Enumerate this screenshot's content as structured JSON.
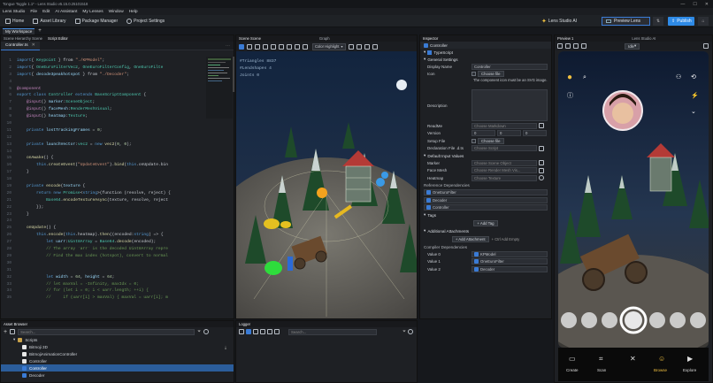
{
  "titlebar": {
    "title": "Tongue Toggle 1.1* - Lens Studio v5.15.0.25101518",
    "min": "—",
    "max": "☐",
    "close": "✕"
  },
  "menu": [
    "Lens Studio",
    "File",
    "Edit",
    "AI Assistant",
    "My Lenses",
    "Window",
    "Help"
  ],
  "toolbar": {
    "home": "Home",
    "asset_library": "Asset Library",
    "package_manager": "Package Manager",
    "project_settings": "Project Settings",
    "ai_label": "Lens Studio AI",
    "preview_lens": "Preview Lens",
    "publish": "Publish"
  },
  "workspace": {
    "tab": "My Workspace",
    "add": "+"
  },
  "editor": {
    "tabs": [
      "Scene Hierarchy Scene",
      "Script Editor"
    ],
    "file_tab": "Controller.ts",
    "lines": [
      {
        "n": "1",
        "segs": [
          [
            "kw",
            "import"
          ],
          [
            "",
            "{ "
          ],
          [
            "cls",
            "Keypoint"
          ],
          [
            "",
            " } from "
          ],
          [
            "str",
            "\"./KPModel\""
          ],
          [
            "",
            ";"
          ]
        ]
      },
      {
        "n": "2",
        "segs": [
          [
            "kw",
            "import"
          ],
          [
            "",
            "{ "
          ],
          [
            "cls",
            "OneEuroFilterVec2"
          ],
          [
            "",
            ", "
          ],
          [
            "cls",
            "OneEuroFilterConfig"
          ],
          [
            "",
            ", "
          ],
          [
            "cls",
            "OneEuroFilte"
          ]
        ]
      },
      {
        "n": "3",
        "segs": [
          [
            "kw",
            "import"
          ],
          [
            "",
            "{ "
          ],
          [
            "var",
            "decode3peakhotspot"
          ],
          [
            "",
            " } from "
          ],
          [
            "str",
            "\"./Decoder\""
          ],
          [
            "",
            ";"
          ]
        ]
      },
      {
        "n": "4",
        "segs": []
      },
      {
        "n": "5",
        "segs": [
          [
            "dec",
            "@component"
          ]
        ]
      },
      {
        "n": "6",
        "segs": [
          [
            "kw",
            "export class "
          ],
          [
            "cls",
            "Controller"
          ],
          [
            "kw",
            " extends "
          ],
          [
            "cls",
            "BaseScriptComponent"
          ],
          [
            "",
            " {"
          ]
        ]
      },
      {
        "n": "7",
        "segs": [
          [
            "",
            "    "
          ],
          [
            "dec",
            "@input"
          ],
          [
            "",
            "() "
          ],
          [
            "var",
            "marker"
          ],
          [
            "",
            ":"
          ],
          [
            "cls",
            "SceneObject"
          ],
          [
            "",
            ";"
          ]
        ]
      },
      {
        "n": "8",
        "segs": [
          [
            "",
            "    "
          ],
          [
            "dec",
            "@input"
          ],
          [
            "",
            "() "
          ],
          [
            "var",
            "faceMesh"
          ],
          [
            "",
            ":"
          ],
          [
            "cls",
            "RenderMeshVisual"
          ],
          [
            "",
            ";"
          ]
        ]
      },
      {
        "n": "9",
        "segs": [
          [
            "",
            "    "
          ],
          [
            "dec",
            "@input"
          ],
          [
            "",
            "() "
          ],
          [
            "var",
            "heatmap"
          ],
          [
            "",
            ":"
          ],
          [
            "cls",
            "Texture"
          ],
          [
            "",
            ";"
          ]
        ]
      },
      {
        "n": "10",
        "segs": []
      },
      {
        "n": "11",
        "segs": [
          [
            "",
            "    "
          ],
          [
            "kw",
            "private "
          ],
          [
            "var",
            "lostTrackingFrames"
          ],
          [
            "",
            " = "
          ],
          [
            "num",
            "0"
          ],
          [
            "",
            ";"
          ]
        ]
      },
      {
        "n": "12",
        "segs": []
      },
      {
        "n": "13",
        "segs": [
          [
            "",
            "    "
          ],
          [
            "kw",
            "private "
          ],
          [
            "var",
            "launchVector"
          ],
          [
            "",
            ":"
          ],
          [
            "cls",
            "vec2"
          ],
          [
            "",
            " = "
          ],
          [
            "kw",
            "new "
          ],
          [
            "fn",
            "vec2"
          ],
          [
            "",
            "("
          ],
          [
            "num",
            "0"
          ],
          [
            "",
            ", "
          ],
          [
            "num",
            "0"
          ],
          [
            "",
            ");"
          ]
        ]
      },
      {
        "n": "14",
        "segs": []
      },
      {
        "n": "15",
        "segs": [
          [
            "",
            "    "
          ],
          [
            "fn",
            "onAwake"
          ],
          [
            "",
            "() {"
          ]
        ]
      },
      {
        "n": "16",
        "segs": [
          [
            "",
            "        "
          ],
          [
            "kw",
            "this"
          ],
          [
            "",
            "."
          ],
          [
            "fn",
            "createEvent"
          ],
          [
            "",
            "("
          ],
          [
            "str",
            "\"UpdateEvent\""
          ],
          [
            "",
            ")."
          ],
          [
            "fn",
            "bind"
          ],
          [
            "",
            "("
          ],
          [
            "kw",
            "this"
          ],
          [
            "",
            ".onUpdate.bin"
          ]
        ]
      },
      {
        "n": "17",
        "segs": [
          [
            "",
            "    }"
          ]
        ]
      },
      {
        "n": "18",
        "segs": []
      },
      {
        "n": "19",
        "segs": [
          [
            "",
            "    "
          ],
          [
            "kw",
            "private "
          ],
          [
            "fn",
            "encode"
          ],
          [
            "",
            "("
          ],
          [
            "var",
            "texture"
          ],
          [
            "",
            " {"
          ]
        ]
      },
      {
        "n": "20",
        "segs": [
          [
            "",
            "        "
          ],
          [
            "kw",
            "return new "
          ],
          [
            "cls",
            "Promise"
          ],
          [
            "",
            "<"
          ],
          [
            "kw",
            "string"
          ],
          [
            "",
            ">"
          ],
          [
            "",
            "(function (resolve, reject) {"
          ]
        ]
      },
      {
        "n": "21",
        "segs": [
          [
            "",
            "            "
          ],
          [
            "cls",
            "Base64"
          ],
          [
            "",
            "."
          ],
          [
            "fn",
            "encodeTextureAsync"
          ],
          [
            "",
            "(texture, resolve, reject"
          ]
        ]
      },
      {
        "n": "22",
        "segs": [
          [
            "",
            "        });"
          ]
        ]
      },
      {
        "n": "23",
        "segs": [
          [
            "",
            "    }"
          ]
        ]
      },
      {
        "n": "24",
        "segs": []
      },
      {
        "n": "25",
        "segs": [
          [
            "",
            "    "
          ],
          [
            "fn",
            "onUpdate"
          ],
          [
            "",
            "() {"
          ]
        ]
      },
      {
        "n": "26",
        "segs": [
          [
            "",
            "        "
          ],
          [
            "kw",
            "this"
          ],
          [
            "",
            "."
          ],
          [
            "fn",
            "encode"
          ],
          [
            "",
            "("
          ],
          [
            "kw",
            "this"
          ],
          [
            "",
            ".heatmap)."
          ],
          [
            "fn",
            "then"
          ],
          [
            "",
            "((encoded:"
          ],
          [
            "kw",
            "string"
          ],
          [
            "",
            ") => {"
          ]
        ]
      },
      {
        "n": "27",
        "segs": [
          [
            "",
            "            "
          ],
          [
            "kw",
            "let "
          ],
          [
            "var",
            "uarr"
          ],
          [
            "",
            ":"
          ],
          [
            "cls",
            "Uint8Array"
          ],
          [
            "",
            " = "
          ],
          [
            "cls",
            "Base64"
          ],
          [
            "",
            "."
          ],
          [
            "fn",
            "decode"
          ],
          [
            "",
            "(encoded);"
          ]
        ]
      },
      {
        "n": "28",
        "segs": [
          [
            "cm",
            "            // The array `arr` is the decoded Uint8Array repre"
          ]
        ]
      },
      {
        "n": "29",
        "segs": [
          [
            "cm",
            "            // Find the max index (hotspot), convert to normal"
          ]
        ]
      },
      {
        "n": "30",
        "segs": []
      },
      {
        "n": "31",
        "segs": []
      },
      {
        "n": "32",
        "segs": [
          [
            "",
            "            "
          ],
          [
            "kw",
            "let "
          ],
          [
            "var",
            "width"
          ],
          [
            "",
            " = "
          ],
          [
            "num",
            "64"
          ],
          [
            "",
            ", "
          ],
          [
            "var",
            "height"
          ],
          [
            "",
            " = "
          ],
          [
            "num",
            "64"
          ],
          [
            "",
            ";"
          ]
        ]
      },
      {
        "n": "33",
        "segs": [
          [
            "cm",
            "            // let maxVal = -Infinity, maxIdx = 0;"
          ]
        ]
      },
      {
        "n": "34",
        "segs": [
          [
            "cm",
            "            // for (let i = 0; i < uarr.length; ++i) {"
          ]
        ]
      },
      {
        "n": "35",
        "segs": [
          [
            "cm",
            "            //     if (uarr[i] > maxVal) { maxVal = uarr[i]; m"
          ]
        ]
      }
    ]
  },
  "scene": {
    "tab": "Scene Scene",
    "graph_tab": "Graph",
    "highlight": "Color Highlight",
    "stats": [
      "#Triangles   8837",
      "#Lendshapes  4",
      "Joints       0"
    ]
  },
  "inspector": {
    "tab": "Inspector",
    "object": "Controller",
    "component": "TypeScript",
    "general": "General Settings",
    "display_name_label": "Display Name",
    "display_name": "Controller",
    "icon_label": "Icon",
    "choose_file": "Choose file",
    "icon_hint": "The component icon must be an SVG image.",
    "description_label": "Description",
    "readme_label": "ReadMe",
    "choose_markdown": "Choose Markdown",
    "version_label": "Version",
    "version": [
      "0",
      "0",
      "0"
    ],
    "setup_label": "Setup File",
    "choose_file2": "Choose file",
    "decl_label": "Declaration File .d.ts",
    "choose_script": "Choose Script",
    "default_inputs": "Default Input Values",
    "marker_label": "Marker",
    "marker": "Choose Scene Object",
    "facemesh_label": "Face Mesh",
    "facemesh": "Choose Render Mesh Vis...",
    "heatmap_label": "Heatmap",
    "heatmap": "Choose Texture",
    "ref_deps": "Reference Dependencies",
    "deps": [
      "OneEuroFilter",
      "Decoder",
      "Controller"
    ],
    "tags": "Tags",
    "add_tag": "+ Add Tag",
    "attachments": "Additional Attachments",
    "add_attachment": "+ Add Attachment",
    "add_empty": "+ Ctrl Add Empty",
    "compiler_deps": "Compiler Dependencies",
    "values": [
      {
        "label": "Value 0",
        "val": "KPModel"
      },
      {
        "label": "Value 1",
        "val": "OneEuroFilter"
      },
      {
        "label": "Value 2",
        "val": "Decoder"
      }
    ]
  },
  "preview": {
    "tab": "Preview 1",
    "tab2": "Lens Studio AI",
    "idle": "Idle",
    "nav": [
      "Create",
      "Scan",
      "",
      "Browse",
      "Explore"
    ]
  },
  "asset_browser": {
    "tab": "Asset Browser",
    "search": "Search...",
    "items": [
      "Scripts",
      "Bitmoji 3D",
      "BitmojiAnimationController",
      "Controller",
      "Controller",
      "Decoder"
    ]
  },
  "logger": {
    "tab": "Logger",
    "search": "Search..."
  },
  "colors": {
    "accent": "#3a7bd5",
    "publish": "#2e8ae6"
  }
}
